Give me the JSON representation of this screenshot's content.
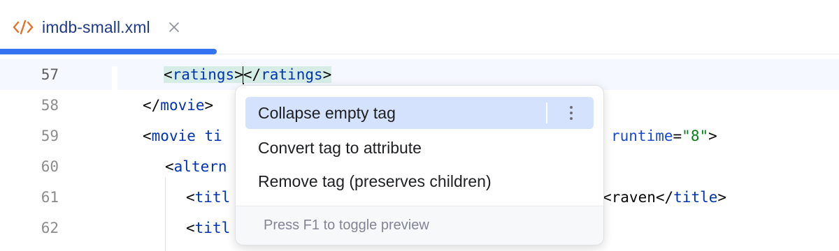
{
  "tab": {
    "title": "imdb-small.xml",
    "icon": "xml-file-icon",
    "close_icon": "close-icon",
    "accent": "#3574f0"
  },
  "editor": {
    "lines": [
      {
        "number": "57",
        "current": true,
        "segments": [
          {
            "t": "<",
            "c": "punct",
            "hl": true
          },
          {
            "t": "ratings",
            "c": "tagname",
            "hl": true
          },
          {
            "t": ">",
            "c": "punct",
            "hl": true
          },
          {
            "t": "</",
            "c": "punct",
            "hl": true
          },
          {
            "t": "ratings",
            "c": "tagname",
            "hl": true
          },
          {
            "t": ">",
            "c": "punct",
            "hl": true
          }
        ]
      },
      {
        "number": "58",
        "segments": [
          {
            "t": "</",
            "c": "punct"
          },
          {
            "t": "movie",
            "c": "tagname"
          },
          {
            "t": ">",
            "c": "punct"
          }
        ]
      },
      {
        "number": "59",
        "segments": [
          {
            "t": "<",
            "c": "punct"
          },
          {
            "t": "movie ti",
            "c": "tagname"
          }
        ],
        "tail": [
          {
            "t": "runtime",
            "c": "attrname"
          },
          {
            "t": "=",
            "c": "punct"
          },
          {
            "t": "\"8\"",
            "c": "attrval"
          },
          {
            "t": ">",
            "c": "punct"
          }
        ]
      },
      {
        "number": "60",
        "segments": [
          {
            "t": "<",
            "c": "punct"
          },
          {
            "t": "altern",
            "c": "tagname"
          }
        ]
      },
      {
        "number": "61",
        "segments": [
          {
            "t": "<",
            "c": "punct"
          },
          {
            "t": "titl",
            "c": "tagname"
          }
        ],
        "tail": [
          {
            "t": "<raven</",
            "c": "punct"
          },
          {
            "t": "title",
            "c": "tagname"
          },
          {
            "t": ">",
            "c": "punct"
          }
        ]
      },
      {
        "number": "62",
        "segments": [
          {
            "t": "<",
            "c": "punct"
          },
          {
            "t": "titl",
            "c": "tagname"
          }
        ]
      }
    ]
  },
  "popup": {
    "items": [
      {
        "label": "Collapse empty tag",
        "selected": true
      },
      {
        "label": "Convert tag to attribute"
      },
      {
        "label": "Remove tag (preserves children)"
      }
    ],
    "more_icon": "more-vertical-icon",
    "footer": "Press F1 to toggle preview"
  },
  "colors": {
    "tag": "#0033b3",
    "attribute": "#174ad4",
    "attribute_value": "#067d17",
    "tag_highlight": "#d6ede6",
    "selection": "#d4e2fe"
  }
}
